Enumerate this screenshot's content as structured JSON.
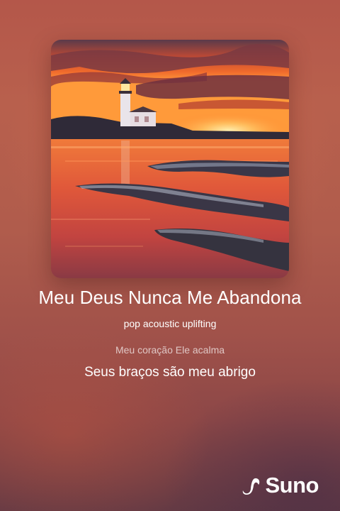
{
  "song": {
    "title": "Meu Deus Nunca Me Abandona",
    "tags": "pop acoustic uplifting"
  },
  "lyrics": {
    "previous": "Meu coração Ele acalma",
    "current": "Seus braços são meu abrigo"
  },
  "artwork": {
    "icon": "lighthouse-sunset-artwork"
  },
  "brand": {
    "name": "Suno",
    "icon": "suno-logo-icon"
  },
  "colors": {
    "background_top": "#b4574a",
    "background_bottom": "#643a44",
    "text": "#ffffff"
  }
}
